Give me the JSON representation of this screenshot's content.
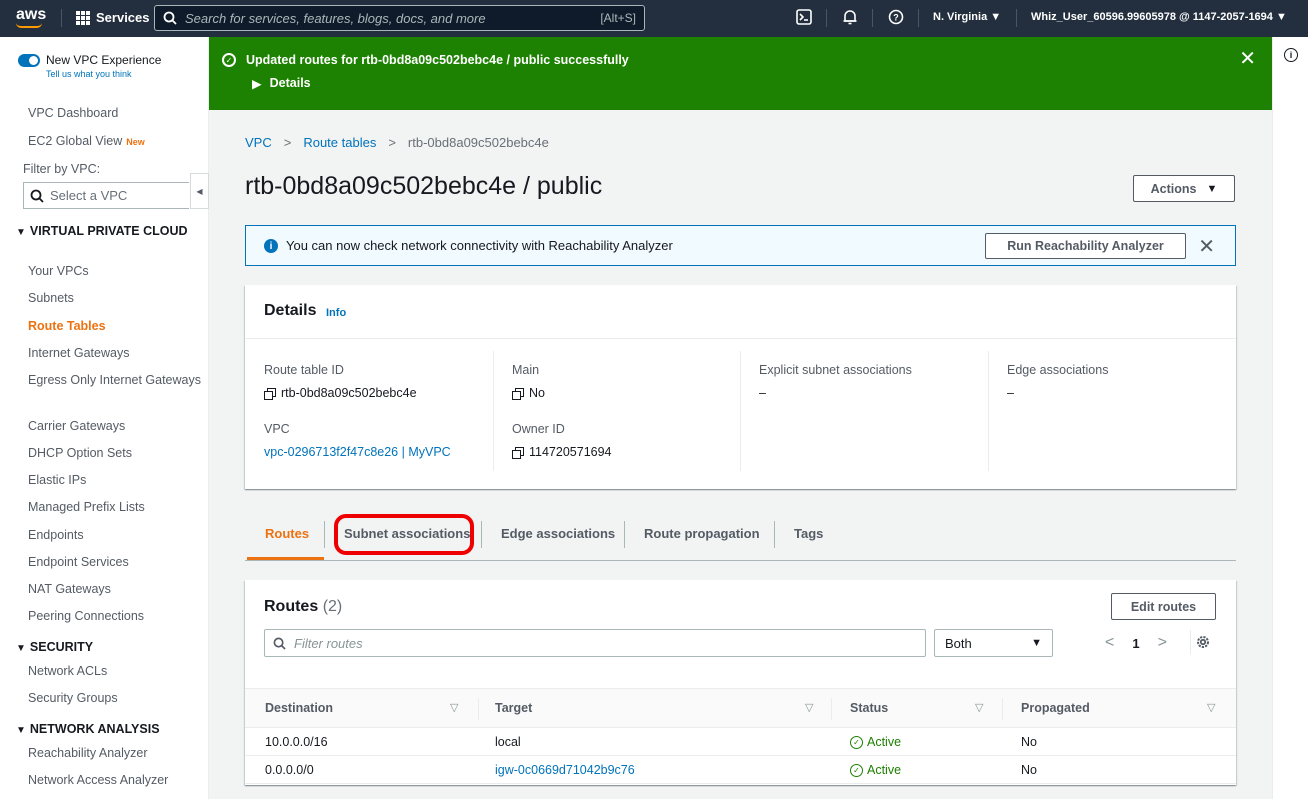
{
  "topnav": {
    "logo": "aws",
    "services": "Services",
    "search_placeholder": "Search for services, features, blogs, docs, and more",
    "search_shortcut": "[Alt+S]",
    "region": "N. Virginia ▼",
    "user": "Whiz_User_60596.99605978 @ 1147-2057-1694 ▼"
  },
  "sidebar": {
    "toggle_label": "New VPC Experience",
    "toggle_sub": "Tell us what you think",
    "vpc_dashboard": "VPC Dashboard",
    "ec2_global_view": "EC2 Global View",
    "new_badge": "New",
    "filter_label": "Filter by VPC:",
    "filter_placeholder": "Select a VPC",
    "section_vpc": "VIRTUAL PRIVATE CLOUD",
    "vpc_items": [
      "Your VPCs",
      "Subnets",
      "Route Tables",
      "Internet Gateways",
      "Egress Only Internet Gateways",
      "Carrier Gateways",
      "DHCP Option Sets",
      "Elastic IPs",
      "Managed Prefix Lists",
      "Endpoints",
      "Endpoint Services",
      "NAT Gateways",
      "Peering Connections"
    ],
    "section_security": "SECURITY",
    "security_items": [
      "Network ACLs",
      "Security Groups"
    ],
    "section_network": "NETWORK ANALYSIS",
    "network_items": [
      "Reachability Analyzer",
      "Network Access Analyzer"
    ]
  },
  "flash": {
    "message": "Updated routes for rtb-0bd8a09c502bebc4e / public successfully",
    "details": "Details"
  },
  "breadcrumb": {
    "vpc": "VPC",
    "route_tables": "Route tables",
    "current": "rtb-0bd8a09c502bebc4e"
  },
  "page": {
    "title": "rtb-0bd8a09c502bebc4e / public",
    "actions": "Actions"
  },
  "banner": {
    "text": "You can now check network connectivity with Reachability Analyzer",
    "button": "Run Reachability Analyzer"
  },
  "details": {
    "title": "Details",
    "info": "Info",
    "route_table_id_label": "Route table ID",
    "route_table_id": "rtb-0bd8a09c502bebc4e",
    "vpc_label": "VPC",
    "vpc_value": "vpc-0296713f2f47c8e26 | MyVPC",
    "main_label": "Main",
    "main_value": "No",
    "owner_label": "Owner ID",
    "owner_value": "114720571694",
    "subnet_assoc_label": "Explicit subnet associations",
    "subnet_assoc_value": "–",
    "edge_assoc_label": "Edge associations",
    "edge_assoc_value": "–"
  },
  "tabs": [
    "Routes",
    "Subnet associations",
    "Edge associations",
    "Route propagation",
    "Tags"
  ],
  "routes": {
    "title": "Routes",
    "count": "(2)",
    "edit_button": "Edit routes",
    "filter_placeholder": "Filter routes",
    "select_value": "Both",
    "page_number": "1",
    "columns": [
      "Destination",
      "Target",
      "Status",
      "Propagated"
    ],
    "rows": [
      {
        "destination": "10.0.0.0/16",
        "target": "local",
        "status": "Active",
        "propagated": "No"
      },
      {
        "destination": "0.0.0.0/0",
        "target": "igw-0c0669d71042b9c76",
        "status": "Active",
        "propagated": "No"
      }
    ]
  }
}
